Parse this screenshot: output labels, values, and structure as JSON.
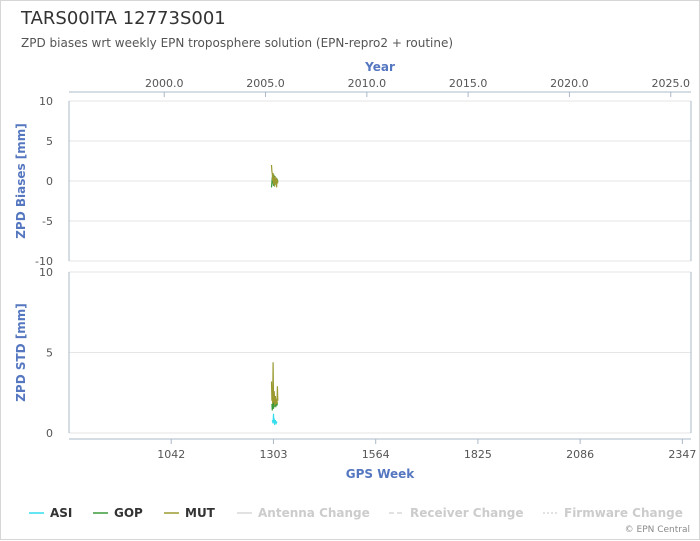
{
  "header": {
    "title": "TARS00ITA 12773S001",
    "subtitle": "ZPD biases wrt weekly EPN troposphere solution (EPN-repro2 + routine)"
  },
  "footer": {
    "credit": "© EPN Central"
  },
  "chart_data": {
    "type": "line",
    "x_top": {
      "label": "Year",
      "ticks": [
        "2000.0",
        "2005.0",
        "2010.0",
        "2015.0",
        "2020.0",
        "2025.0"
      ],
      "range": [
        1995.3,
        2026.0
      ]
    },
    "x_bottom": {
      "label": "GPS Week",
      "ticks": [
        "1042",
        "1303",
        "1564",
        "1825",
        "2086",
        "2347"
      ],
      "range": [
        781,
        2369
      ]
    },
    "panels": [
      {
        "id": "bias",
        "ylabel": "ZPD Biases [mm]",
        "ylim": [
          -10,
          10
        ],
        "yticks": [
          "10",
          "5",
          "0",
          "-5",
          "-10"
        ],
        "grid": true,
        "series": [
          {
            "name": "GOP",
            "color": "#3a9a3a",
            "x": [
              1298,
              1300,
              1301,
              1302,
              1303,
              1304,
              1305,
              1306,
              1307,
              1308,
              1309,
              1310,
              1311,
              1312,
              1313,
              1314
            ],
            "y": [
              -0.8,
              0.5,
              -0.3,
              0.2,
              -0.6,
              0.8,
              0.0,
              -0.4,
              0.6,
              -0.2,
              0.3,
              -0.5,
              0.4,
              0.0,
              0.2,
              -0.1
            ]
          },
          {
            "name": "MUT",
            "color": "#9a9a30",
            "x": [
              1298,
              1299,
              1300,
              1301,
              1302,
              1303,
              1304,
              1305,
              1306,
              1307,
              1308,
              1309,
              1310,
              1311,
              1312,
              1313,
              1314
            ],
            "y": [
              2.0,
              1.2,
              0.9,
              0.0,
              1.0,
              -0.4,
              0.5,
              0.2,
              -0.7,
              0.6,
              0.1,
              -0.3,
              0.4,
              -0.8,
              0.2,
              0.0,
              -0.3
            ]
          }
        ]
      },
      {
        "id": "std",
        "ylabel": "ZPD STD [mm]",
        "ylim": [
          0,
          10
        ],
        "yticks": [
          "10",
          "5",
          "0"
        ],
        "grid": true,
        "series": [
          {
            "name": "ASI",
            "color": "#33ddee",
            "x": [
              1300,
              1302,
              1303,
              1304,
              1305,
              1306,
              1308,
              1310,
              1312
            ],
            "y": [
              0.8,
              0.6,
              1.2,
              0.7,
              0.9,
              0.5,
              0.8,
              0.6,
              0.7
            ]
          },
          {
            "name": "GOP",
            "color": "#3a9a3a",
            "x": [
              1299,
              1300,
              1301,
              1302,
              1303,
              1304,
              1305,
              1306,
              1307,
              1308,
              1309,
              1310,
              1311,
              1312,
              1313
            ],
            "y": [
              1.8,
              1.4,
              2.0,
              1.6,
              1.5,
              1.9,
              1.6,
              2.1,
              1.7,
              1.9,
              1.6,
              2.0,
              1.8,
              1.7,
              1.9
            ]
          },
          {
            "name": "MUT",
            "color": "#9a9a30",
            "x": [
              1298,
              1299,
              1300,
              1301,
              1302,
              1303,
              1304,
              1305,
              1306,
              1307,
              1308,
              1309,
              1310,
              1311,
              1312,
              1313,
              1314
            ],
            "y": [
              3.2,
              2.0,
              2.4,
              1.8,
              4.4,
              2.2,
              1.9,
              2.6,
              2.0,
              1.7,
              2.3,
              1.9,
              1.8,
              2.1,
              1.8,
              2.9,
              2.0
            ]
          }
        ]
      }
    ],
    "legend": {
      "position": "bottom",
      "items": [
        {
          "label": "ASI",
          "color": "#33ddee",
          "style": "solid",
          "active": true
        },
        {
          "label": "GOP",
          "color": "#3a9a3a",
          "style": "solid",
          "active": true
        },
        {
          "label": "MUT",
          "color": "#9a9a30",
          "style": "solid",
          "active": true
        },
        {
          "label": "Antenna Change",
          "color": "#d8d8d8",
          "style": "solid",
          "active": false
        },
        {
          "label": "Receiver Change",
          "color": "#d8d8d8",
          "style": "dashed",
          "active": false
        },
        {
          "label": "Firmware Change",
          "color": "#d8d8d8",
          "style": "dotted",
          "active": false
        }
      ]
    }
  }
}
